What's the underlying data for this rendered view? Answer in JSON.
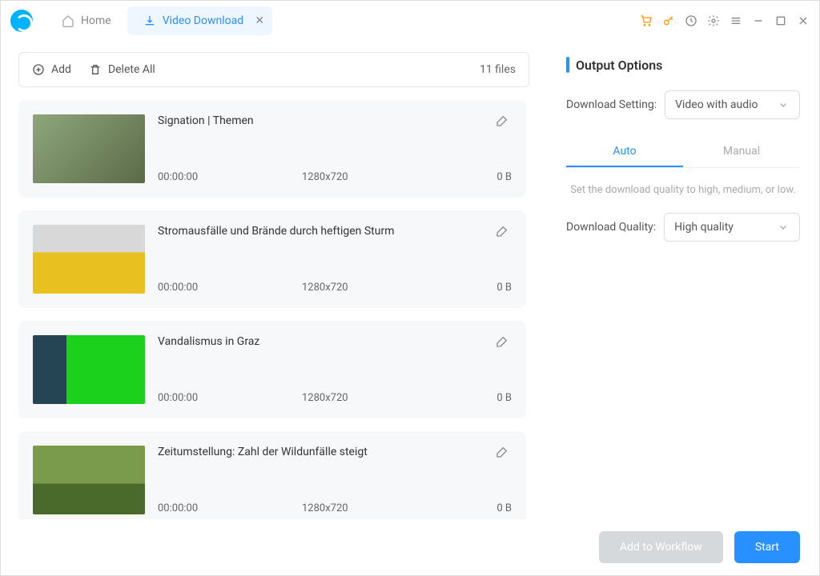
{
  "tabs": {
    "home": "Home",
    "active": "Video Download"
  },
  "toolbar": {
    "add": "Add",
    "deleteAll": "Delete All",
    "count": "11 files"
  },
  "items": [
    {
      "title": "Signation | Themen",
      "dur": "00:00:00",
      "res": "1280x720",
      "size": "0 B"
    },
    {
      "title": "Stromausfälle und Brände durch heftigen Sturm",
      "dur": "00:00:00",
      "res": "1280x720",
      "size": "0 B"
    },
    {
      "title": "Vandalismus in Graz",
      "dur": "00:00:00",
      "res": "1280x720",
      "size": "0 B"
    },
    {
      "title": "Zeitumstellung: Zahl der Wildunfälle steigt",
      "dur": "00:00:00",
      "res": "1280x720",
      "size": "0 B"
    }
  ],
  "options": {
    "header": "Output Options",
    "settingLabel": "Download Setting:",
    "settingValue": "Video with audio",
    "tabAuto": "Auto",
    "tabManual": "Manual",
    "hint": "Set the download quality to high, medium, or low.",
    "qualityLabel": "Download Quality:",
    "qualityValue": "High quality"
  },
  "footer": {
    "workflow": "Add to Workflow",
    "start": "Start"
  }
}
